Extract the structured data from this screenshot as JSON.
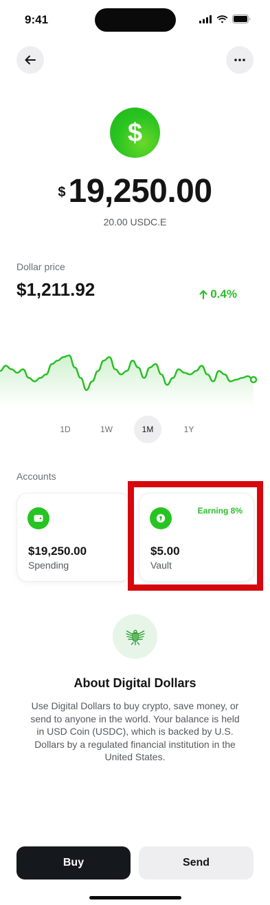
{
  "status_bar": {
    "time": "9:41"
  },
  "header": {
    "back_icon": "arrow-left-icon",
    "more_icon": "ellipsis-icon"
  },
  "asset": {
    "icon": "dollar-coin-icon",
    "icon_glyph": "$",
    "balance_symbol": "$",
    "balance_amount": "19,250.00",
    "sub_balance": "20.00 USDC.E"
  },
  "price": {
    "label": "Dollar price",
    "value": "$1,211.92",
    "change": "0.4%",
    "change_icon": "arrow-up-icon",
    "change_color": "#2bbf28"
  },
  "chart_data": {
    "type": "area",
    "title": "",
    "xlabel": "",
    "ylabel": "",
    "values": [
      54,
      57,
      55,
      53,
      55,
      50,
      48,
      50,
      52,
      58,
      60,
      62,
      63,
      56,
      50,
      43,
      48,
      54,
      60,
      62,
      55,
      52,
      54,
      60,
      56,
      50,
      56,
      58,
      52,
      46,
      50,
      55,
      53,
      52,
      54,
      57,
      52,
      48,
      54,
      52,
      48,
      49,
      50,
      51,
      49
    ],
    "ylim": [
      35,
      70
    ],
    "grid": false,
    "legend": "none",
    "line_color": "#2bbf28"
  },
  "ranges": {
    "items": [
      "1D",
      "1W",
      "1M",
      "1Y"
    ],
    "selected": "1M"
  },
  "accounts": {
    "label": "Accounts",
    "spending": {
      "amount": "$19,250.00",
      "label": "Spending",
      "icon": "wallet-icon"
    },
    "vault": {
      "amount": "$5.00",
      "label": "Vault",
      "badge": "Earning 8%",
      "icon": "vault-lock-icon"
    }
  },
  "about": {
    "icon": "eagle-emblem-icon",
    "title": "About Digital Dollars",
    "body": "Use Digital Dollars to buy crypto, save money, or send to anyone in the world. Your balance is held in USD Coin (USDC), which is backed by U.S. Dollars by a regulated financial institution in the United States."
  },
  "actions": {
    "buy": "Buy",
    "send": "Send"
  },
  "colors": {
    "accent_green": "#26c421",
    "highlight_red": "#d6070d",
    "dark_button": "#15181c"
  }
}
